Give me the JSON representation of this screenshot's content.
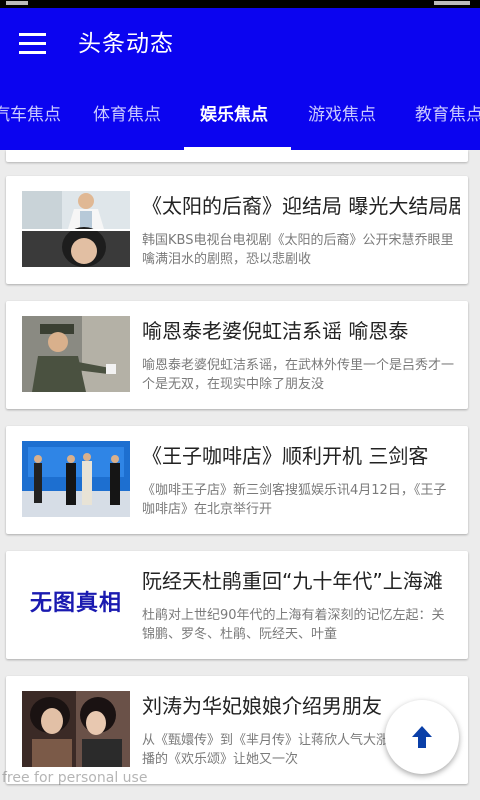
{
  "app": {
    "title": "头条动态"
  },
  "tabs": [
    {
      "label": "汽车焦点",
      "active": false
    },
    {
      "label": "体育焦点",
      "active": false
    },
    {
      "label": "娱乐焦点",
      "active": true
    },
    {
      "label": "游戏焦点",
      "active": false
    },
    {
      "label": "教育焦点",
      "active": false
    }
  ],
  "news": [
    {
      "title": "《太阳的后裔》迎结局 曝光大结局剧照",
      "desc": "韩国KBS电视台电视剧《太阳的后裔》公开宋慧乔眼里噙满泪水的剧照，恐以悲剧收",
      "image": "drama-stills-photo"
    },
    {
      "title": "喻恩泰老婆倪虹洁系谣 喻恩泰",
      "desc": "喻恩泰老婆倪虹洁系谣，在武林外传里一个是吕秀才一个是无双，在现实中除了朋友没",
      "image": "actor-uniform-photo"
    },
    {
      "title": "《王子咖啡店》顺利开机 三剑客",
      "desc": "《咖啡王子店》新三剑客搜狐娱乐讯4月12日，《王子咖啡店》在北京举行开",
      "image": "press-event-photo"
    },
    {
      "title": "阮经天杜鹃重回“九十年代”上海滩",
      "desc": "杜鹃对上世纪90年代的上海有着深刻的记忆左起：关锦鹏、罗冬、杜鹃、阮经天、叶童",
      "image": "no-image-placeholder",
      "placeholder_text": "无图真相"
    },
    {
      "title": "刘涛为华妃娘娘介绍男朋友",
      "desc": "从《甄嬛传》到《芈月传》让蒋欣人气大涨，而近日热播的《欢乐颂》让她又一次",
      "image": "costume-drama-photo"
    }
  ],
  "fab": {
    "icon": "arrow-up-icon"
  },
  "watermark": "free for personal use",
  "colors": {
    "primary": "#0b04f0",
    "fab_arrow": "#0a3fa8",
    "title_text": "#222222",
    "desc_text": "#7a7a7a"
  }
}
